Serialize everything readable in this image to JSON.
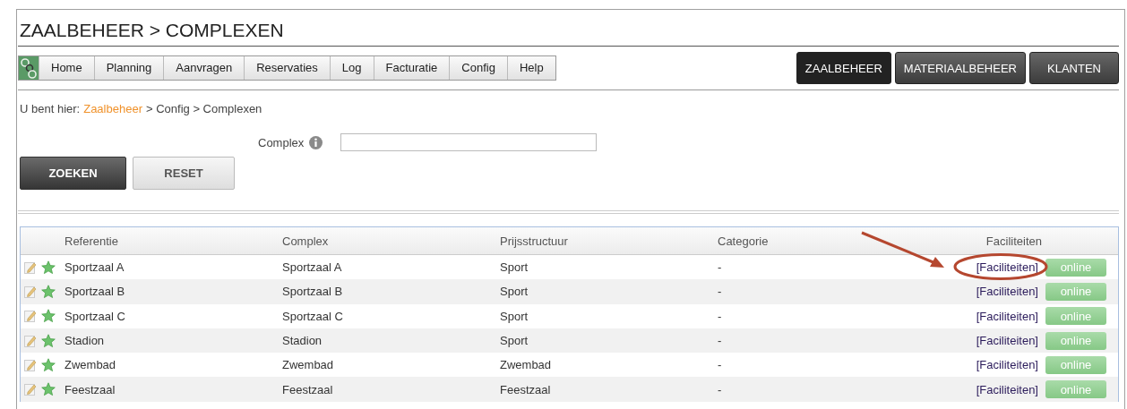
{
  "page_title": "ZAALBEHEER > COMPLEXEN",
  "menu": [
    "Home",
    "Planning",
    "Aanvragen",
    "Reservaties",
    "Log",
    "Facturatie",
    "Config",
    "Help"
  ],
  "modules": [
    {
      "label": "ZAALBEHEER",
      "selected": true
    },
    {
      "label": "MATERIAALBEHEER",
      "selected": false
    },
    {
      "label": "KLANTEN",
      "selected": false
    }
  ],
  "breadcrumb": {
    "prefix": "U bent hier:",
    "link": "Zaalbeheer",
    "rest": "> Config > Complexen"
  },
  "search": {
    "label": "Complex"
  },
  "buttons": [
    {
      "label": "ZOEKEN",
      "kind": "primary"
    },
    {
      "label": "RESET",
      "kind": "secondary"
    }
  ],
  "table": {
    "columns": [
      "Referentie",
      "Complex",
      "Prijsstructuur",
      "Categorie",
      "Faciliteiten"
    ],
    "rows": [
      {
        "referentie": "Sportzaal A",
        "complex": "Sportzaal A",
        "prijsstructuur": "Sport",
        "categorie": "-",
        "faciliteiten": "[Faciliteiten]",
        "status": "online",
        "highlighted": true
      },
      {
        "referentie": "Sportzaal B",
        "complex": "Sportzaal B",
        "prijsstructuur": "Sport",
        "categorie": "-",
        "faciliteiten": "[Faciliteiten]",
        "status": "online",
        "highlighted": false
      },
      {
        "referentie": "Sportzaal C",
        "complex": "Sportzaal C",
        "prijsstructuur": "Sport",
        "categorie": "-",
        "faciliteiten": "[Faciliteiten]",
        "status": "online",
        "highlighted": false
      },
      {
        "referentie": "Stadion",
        "complex": "Stadion",
        "prijsstructuur": "Sport",
        "categorie": "-",
        "faciliteiten": "[Faciliteiten]",
        "status": "online",
        "highlighted": false
      },
      {
        "referentie": "Zwembad",
        "complex": "Zwembad",
        "prijsstructuur": "Zwembad",
        "categorie": "-",
        "faciliteiten": "[Faciliteiten]",
        "status": "online",
        "highlighted": false
      },
      {
        "referentie": "Feestzaal",
        "complex": "Feestzaal",
        "prijsstructuur": "Feestzaal",
        "categorie": "-",
        "faciliteiten": "[Faciliteiten]",
        "status": "online",
        "highlighted": false
      }
    ]
  }
}
